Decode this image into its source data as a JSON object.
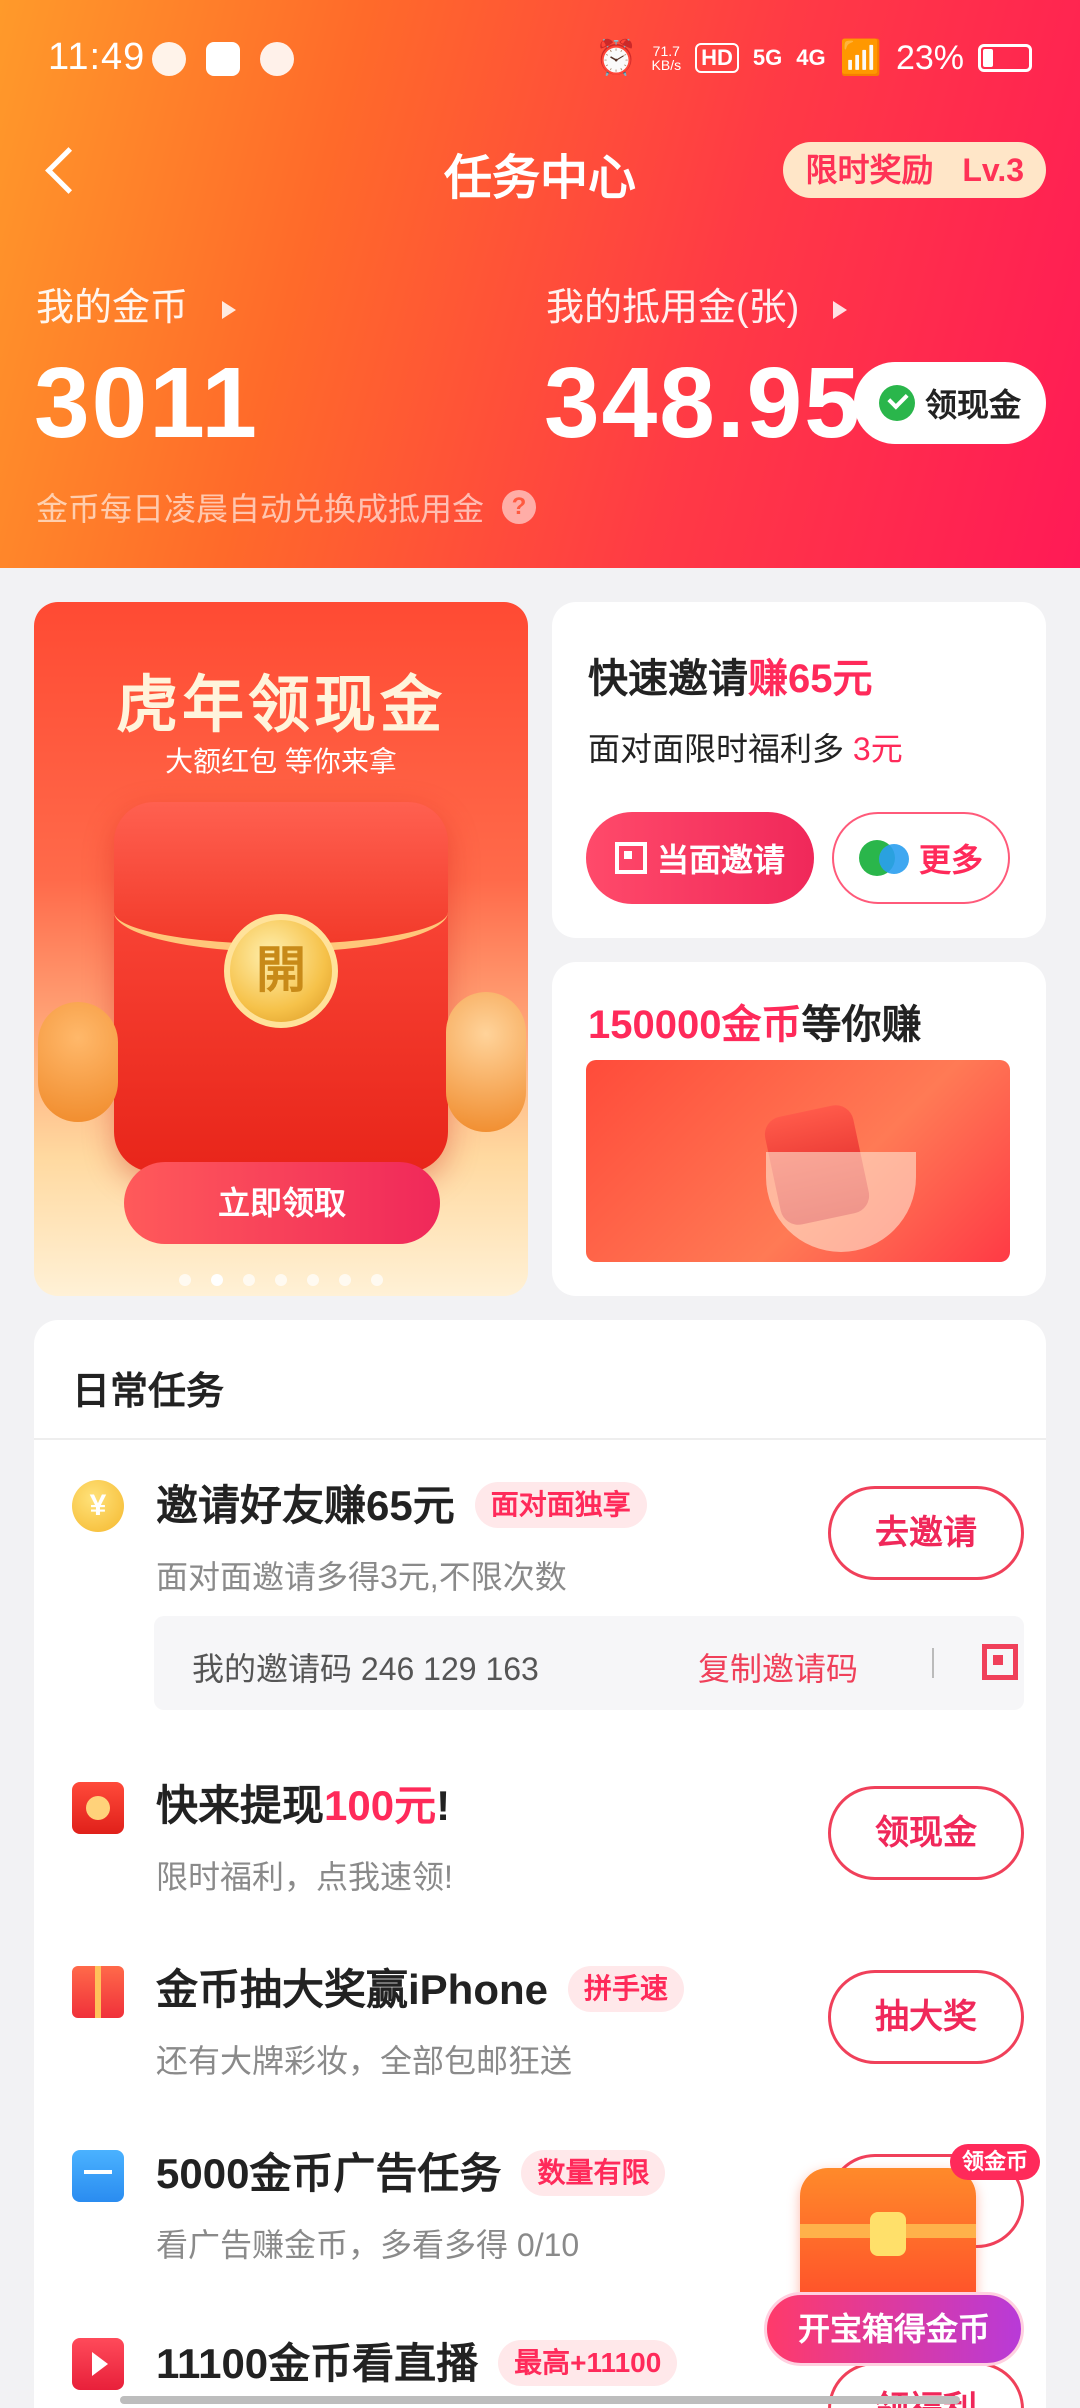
{
  "status_bar": {
    "time": "11:49",
    "net_speed_value": "71.7",
    "net_speed_unit": "KB/s",
    "hd": "HD",
    "signal1": "5G",
    "signal2": "4G",
    "battery": "23%"
  },
  "nav": {
    "title": "任务中心",
    "limit_badge": "限时奖励",
    "level": "Lv.3"
  },
  "wallet": {
    "coins_label": "我的金币",
    "coins_value": "3011",
    "voucher_label": "我的抵用金(张)",
    "voucher_value": "348.95",
    "cash_button": "领现金",
    "notice": "金币每日凌晨自动兑换成抵用金"
  },
  "promo_redpack": {
    "title": "虎年领现金",
    "subtitle": "大额红包 等你来拿",
    "coin_char": "開",
    "button": "立即领取"
  },
  "promo_invite": {
    "title_a": "快速邀请",
    "title_b": "赚65元",
    "sub_a": "面对面限时福利多 ",
    "sub_b": "3元",
    "btn_face": "当面邀请",
    "btn_more": "更多"
  },
  "promo_coins": {
    "title_a": "150000金币",
    "title_b": "等你赚"
  },
  "daily": {
    "title": "日常任务",
    "tasks": [
      {
        "name": "邀请好友赚65元",
        "tag": "面对面独享",
        "desc": "面对面邀请多得3元,不限次数",
        "button": "去邀请",
        "icon": "yen-coin-icon"
      },
      {
        "name_a": "快来提现",
        "name_b": "100元",
        "name_c": "!",
        "desc": "限时福利，点我速领!",
        "button": "领现金",
        "icon": "red-envelope-icon"
      },
      {
        "name": "金币抽大奖赢iPhone",
        "tag": "拼手速",
        "desc": "还有大牌彩妆，全部包邮狂送",
        "button": "抽大奖",
        "icon": "gift-icon"
      },
      {
        "name": "5000金币广告任务",
        "tag": "数量有限",
        "desc": "看广告赚金币，多看多得 0/10",
        "button": "",
        "icon": "tv-icon"
      },
      {
        "name": "11100金币看直播",
        "tag": "最高+11100",
        "button": "领福利",
        "icon": "live-play-icon"
      }
    ],
    "invite_code_label": "我的邀请码 246 129 163",
    "copy_code": "复制邀请码"
  },
  "treasure": {
    "tag": "领金币",
    "button": "开宝箱得金币"
  },
  "colors": {
    "accent": "#ff2a5a",
    "header_start": "#ff9a2a",
    "header_end": "#ff1a56"
  }
}
